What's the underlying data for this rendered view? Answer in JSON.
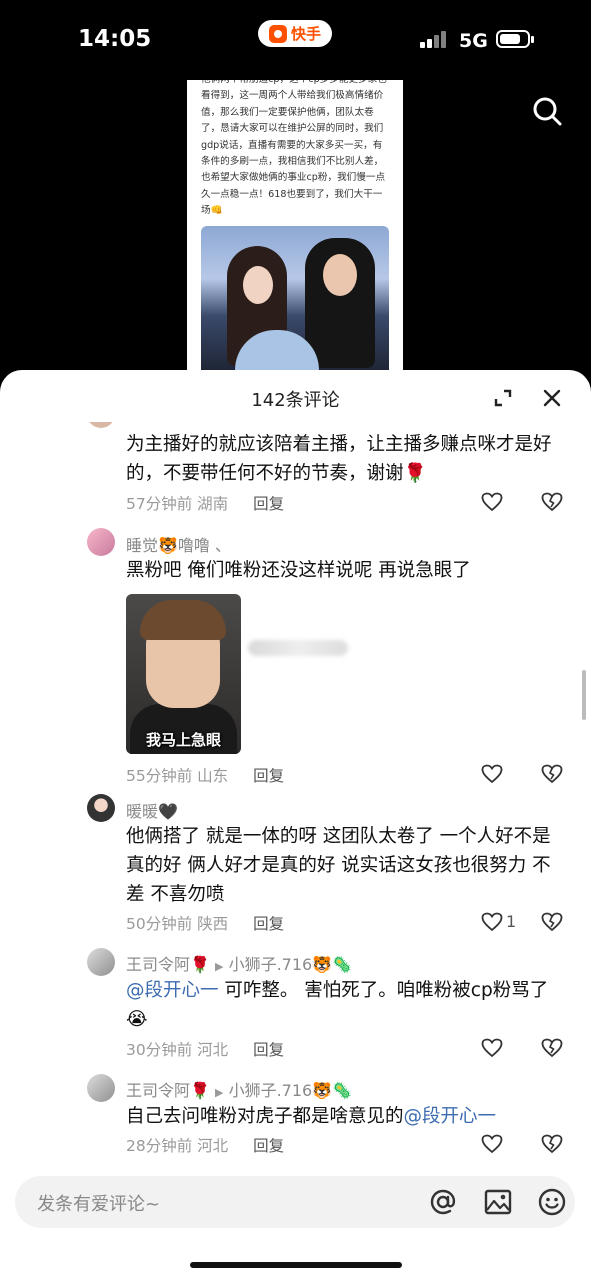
{
  "status_bar": {
    "time": "14:05",
    "app_name": "快手",
    "network": "5G"
  },
  "post": {
    "text": "他俩两个常朋追cp，这个cp多多能更多家也看得到，这一周两个人带给我们极高情绪价值，那么我们一定要保护他俩，团队太卷了，恳请大家可以在维护公屏的同时，我们gdp说话，直播有需要的大家多买一买，有条件的多刷一点，我相信我们不比别人差，也希望大家做她俩的事业cp粉，我们慢一点久一点稳一点！618也要到了，我们大干一场👊"
  },
  "comments_panel": {
    "title": "142条评论",
    "comments": [
      {
        "user": "",
        "text": "为主播好的就应该陪着主播，让主播多赚点咪才是好的，不要带任何不好的节奏，谢谢🌹",
        "time": "57分钟前",
        "location": "湖南",
        "reply": "回复",
        "likes": ""
      },
      {
        "user": "睡觉🐯噜噜 、",
        "text": "黑粉吧 俺们唯粉还没这样说呢 再说急眼了",
        "sticker_caption": "我马上急眼",
        "time": "55分钟前",
        "location": "山东",
        "reply": "回复",
        "likes": ""
      },
      {
        "user": "暖暖🖤",
        "text": "他俩搭了 就是一体的呀 这团队太卷了 一个人好不是真的好 俩人好才是真的好 说实话这女孩也很努力 不差 不喜勿喷",
        "time": "50分钟前",
        "location": "陕西",
        "reply": "回复",
        "likes": "1"
      },
      {
        "user": "王司令阿🌹",
        "reply_to": "小狮子.716🐯🦠",
        "mention": "@段开心一",
        "text": " 可咋整。 害怕死了。咱唯粉被cp粉骂了😭",
        "time": "30分钟前",
        "location": "河北",
        "reply": "回复",
        "likes": ""
      },
      {
        "user": "王司令阿🌹",
        "reply_to": "小狮子.716🐯🦠",
        "text": "自己去问唯粉对虎子都是啥意见的",
        "mention": "@段开心一",
        "time": "28分钟前",
        "location": "河北",
        "reply": "回复",
        "likes": ""
      }
    ]
  },
  "input": {
    "placeholder": "发条有爱评论~"
  },
  "colors": {
    "accent": "#ff5000",
    "mention": "#3d6cb0",
    "meta": "#9a9a9a"
  }
}
